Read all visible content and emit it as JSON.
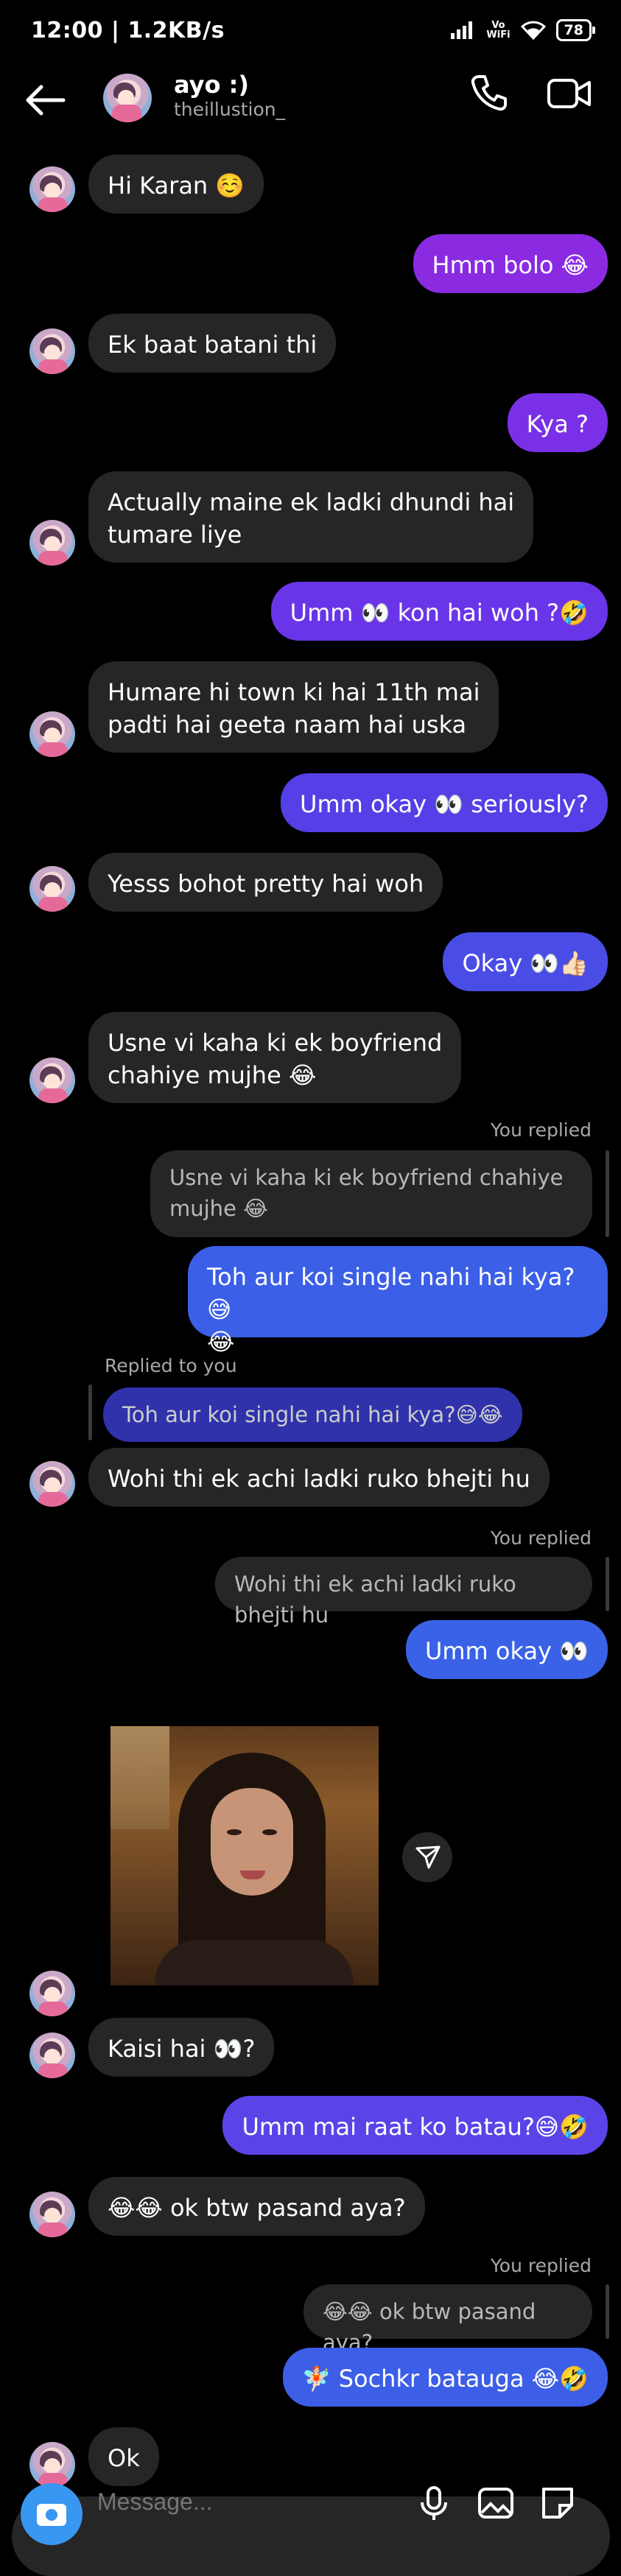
{
  "status_bar": {
    "time": "12:00",
    "speed": "1.2KB/s",
    "vowifi_top": "Vo",
    "vowifi_bottom": "WiFi",
    "battery": "78"
  },
  "header": {
    "name": "ayo :)",
    "username": "theillustion_"
  },
  "colors": {
    "incoming": "#262626",
    "outgoing_purple": "#8a2be2",
    "outgoing_indigo": "#6a35e8",
    "outgoing_blue": "#3b5fe6"
  },
  "messages": [
    {
      "text": "Hi Karan ☺️"
    },
    {
      "text": "Hmm bolo 😂"
    },
    {
      "text": "Ek baat batani thi"
    },
    {
      "text": "Kya ?"
    },
    {
      "text": "Actually maine ek ladki dhundi hai\ntumare liye"
    },
    {
      "text": "Umm 👀 kon hai woh ?🤣"
    },
    {
      "text": "Humare hi town ki hai 11th mai\npadti hai geeta naam hai uska"
    },
    {
      "text": "Umm okay 👀 seriously?"
    },
    {
      "text": "Yesss bohot pretty hai woh"
    },
    {
      "text": "Okay 👀👍🏻"
    },
    {
      "text": "Usne vi kaha ki ek boyfriend\nchahiye mujhe 😂"
    },
    {
      "text": "Toh aur koi single nahi hai kya?😅\n😂"
    },
    {
      "text": "Wohi thi ek achi ladki ruko bhejti hu"
    },
    {
      "text": "Umm okay 👀"
    },
    {
      "text": "Kaisi hai 👀?"
    },
    {
      "text": "Umm mai raat ko batau?😅🤣"
    },
    {
      "text": "😂😂 ok btw pasand aya?"
    },
    {
      "text": "🧚🏻 Sochkr batauga 😂🤣"
    },
    {
      "text": "Ok"
    }
  ],
  "replies": [
    {
      "label": "You replied",
      "quoted": "Usne vi kaha ki ek boyfriend chahiye\nmujhe 😂"
    },
    {
      "label": "Replied to you",
      "quoted": "Toh aur koi single nahi hai kya?😅😂"
    },
    {
      "label": "You replied",
      "quoted": "Wohi thi ek achi ladki ruko bhejti hu"
    },
    {
      "label": "You replied",
      "quoted": "😂😂 ok btw pasand aya?"
    }
  ],
  "composer": {
    "placeholder": "Message..."
  },
  "icons": {
    "back": "arrow-left-icon",
    "call": "phone-icon",
    "video": "video-camera-icon",
    "share": "paper-plane-icon",
    "camera": "camera-icon",
    "mic": "microphone-icon",
    "gallery": "image-icon",
    "sticker": "sticker-icon"
  }
}
